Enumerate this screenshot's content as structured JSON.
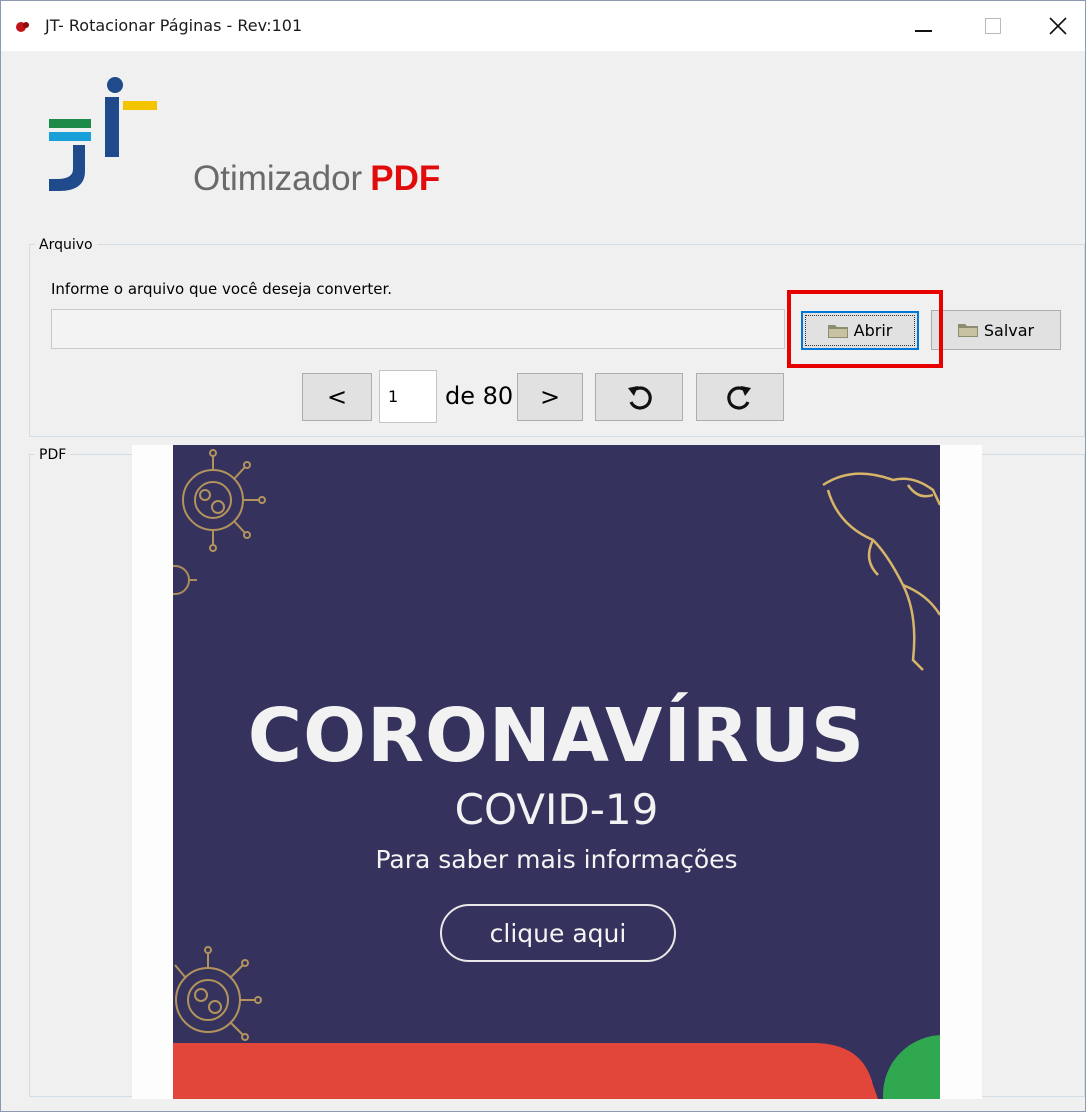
{
  "window": {
    "title": "JT- Rotacionar Páginas - Rev:101",
    "minimize_glyph": "",
    "maximize_glyph": "",
    "close_glyph": "✕"
  },
  "header": {
    "brand_text": "Otimizador",
    "brand_highlight": "PDF",
    "logo_icon": "jt-logo-icon",
    "brand_color": "#e10b0b"
  },
  "arquivo": {
    "legend": "Arquivo",
    "instruction": "Informe o arquivo que você deseja converter.",
    "file_path_value": "",
    "open_label": "Abrir",
    "save_label": "Salvar",
    "open_icon": "folder-icon",
    "save_icon": "folder-icon"
  },
  "navigation": {
    "prev_label": "<",
    "next_label": ">",
    "current_page": "1",
    "total_label": "de 80",
    "rotate_left_icon": "rotate-left-icon",
    "rotate_right_icon": "rotate-right-icon"
  },
  "pdf": {
    "legend": "PDF",
    "page": {
      "title": "CORONAVÍRUS",
      "subtitle": "COVID-19",
      "info": "Para saber mais informações",
      "cta": "clique aqui",
      "background_color": "#35325d"
    }
  },
  "highlight_color": "#e60000"
}
